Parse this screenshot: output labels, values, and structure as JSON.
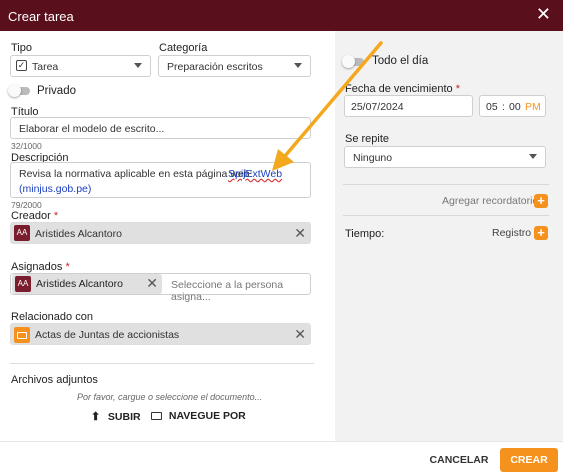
{
  "dialog": {
    "title": "Crear tarea"
  },
  "tipo": {
    "label": "Tipo",
    "value": "Tarea"
  },
  "categoria": {
    "label": "Categoría",
    "value": "Preparación escritos"
  },
  "privado": {
    "label": "Privado"
  },
  "titulo": {
    "label": "Título",
    "value": "Elaborar el modelo de escrito...",
    "counter": "32/1000"
  },
  "descripcion": {
    "label": "Descripción",
    "text": "Revisa la normativa aplicable en esta página web:",
    "link": "SpijExtWeb",
    "link2": "(minjus.gob.pe)",
    "counter": "79/2000"
  },
  "creador": {
    "label": "Creador",
    "required": "*",
    "initials": "AA",
    "name": "Aristides Alcantoro"
  },
  "asignados": {
    "label": "Asignados",
    "required": "*",
    "initials": "AA",
    "name": "Aristides Alcantoro",
    "placeholder": "Seleccione a la persona asigna..."
  },
  "relacionado": {
    "label": "Relacionado con",
    "value": "Actas de Juntas de accionistas"
  },
  "adjuntos": {
    "label": "Archivos adjuntos",
    "hint": "Por favor, cargue o seleccione el documento...",
    "upload": "SUBIR",
    "browse": "NAVEGUE POR"
  },
  "todo_el_dia": {
    "label": "Todo el día"
  },
  "vencimiento": {
    "label": "Fecha de vencimiento",
    "required": "*",
    "date": "25/07/2024",
    "hour": "05",
    "sep": ":",
    "minute": "00",
    "ampm": "PM"
  },
  "repite": {
    "label": "Se repite",
    "value": "Ninguno"
  },
  "recordatorio": {
    "label": "Agregar recordatorio"
  },
  "tiempo": {
    "label": "Tiempo:",
    "action": "Registro"
  },
  "footer": {
    "cancel": "CANCELAR",
    "create": "CREAR"
  },
  "colors": {
    "header": "#5a0f1c",
    "accent": "#f5921e",
    "annotation_arrow": "#f4a81d"
  }
}
